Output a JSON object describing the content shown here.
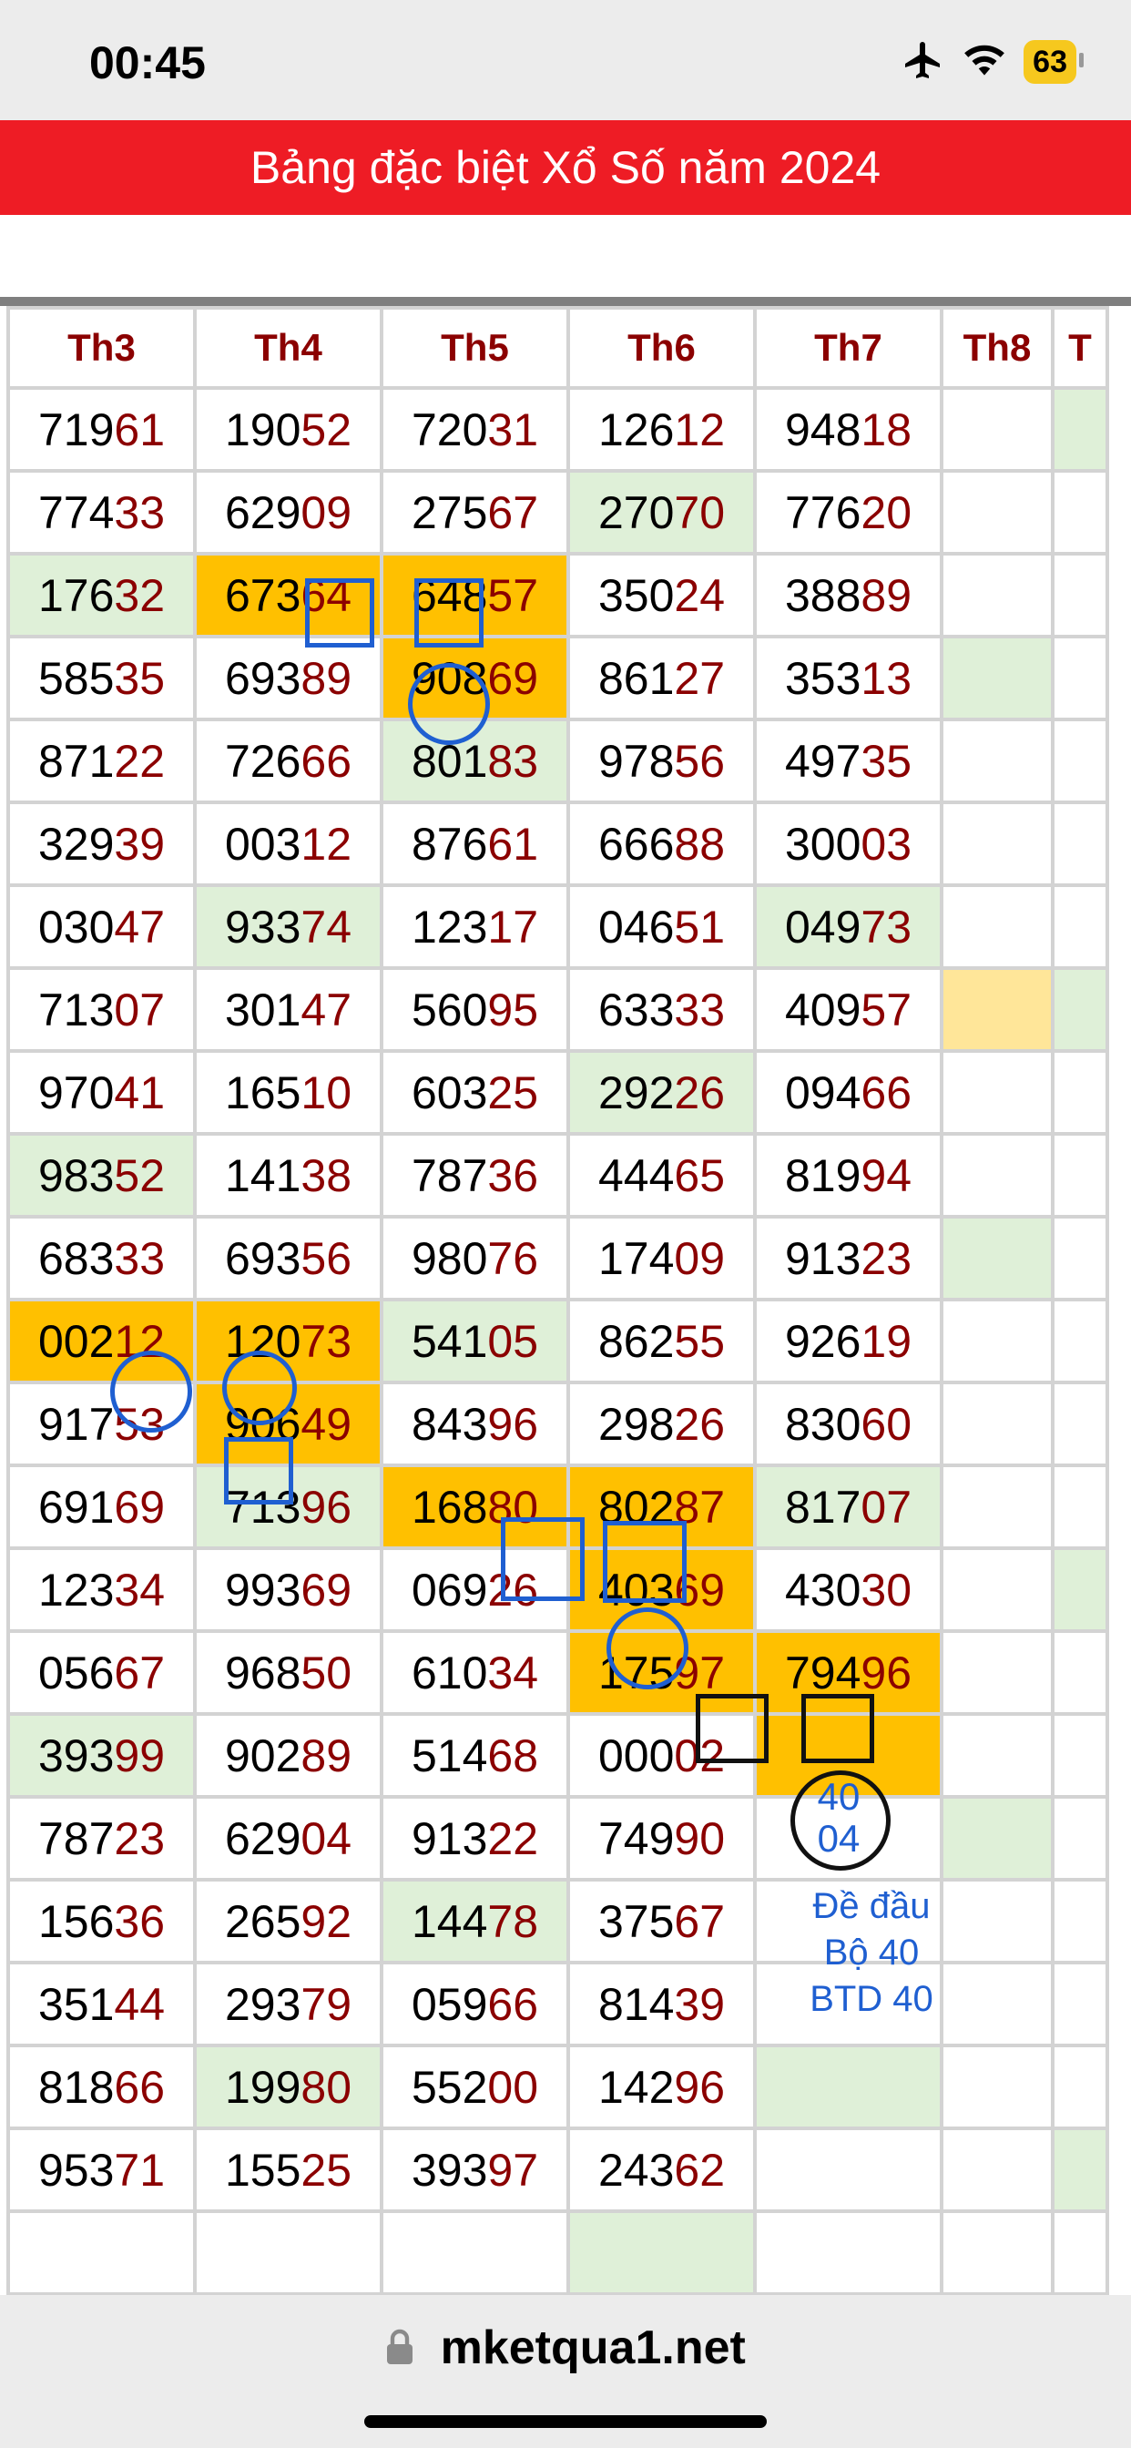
{
  "status": {
    "time": "00:45",
    "battery": "63"
  },
  "header": {
    "title": "Bảng đặc biệt Xổ Số năm 2024"
  },
  "columns": [
    "Th3",
    "Th4",
    "Th5",
    "Th6",
    "Th7",
    "Th8",
    "T"
  ],
  "rows": [
    [
      [
        "719",
        "61",
        ""
      ],
      [
        "190",
        "52",
        ""
      ],
      [
        "720",
        "31",
        ""
      ],
      [
        "126",
        "12",
        ""
      ],
      [
        "948",
        "18",
        ""
      ],
      [
        "",
        "",
        " "
      ],
      [
        "",
        "",
        "g"
      ]
    ],
    [
      [
        "774",
        "33",
        ""
      ],
      [
        "629",
        "09",
        ""
      ],
      [
        "275",
        "67",
        ""
      ],
      [
        "270",
        "70",
        "g"
      ],
      [
        "776",
        "20",
        ""
      ],
      [
        "",
        "",
        ""
      ],
      [
        "",
        "",
        ""
      ]
    ],
    [
      [
        "176",
        "32",
        "g"
      ],
      [
        "673",
        "64",
        "o"
      ],
      [
        "648",
        "57",
        "o"
      ],
      [
        "350",
        "24",
        ""
      ],
      [
        "388",
        "89",
        ""
      ],
      [
        "",
        "",
        ""
      ],
      [
        "",
        "",
        ""
      ]
    ],
    [
      [
        "585",
        "35",
        ""
      ],
      [
        "693",
        "89",
        ""
      ],
      [
        "908",
        "69",
        "o"
      ],
      [
        "861",
        "27",
        ""
      ],
      [
        "353",
        "13",
        ""
      ],
      [
        "",
        "",
        "g"
      ],
      [
        "",
        "",
        ""
      ]
    ],
    [
      [
        "871",
        "22",
        ""
      ],
      [
        "726",
        "66",
        ""
      ],
      [
        "801",
        "83",
        "g"
      ],
      [
        "978",
        "56",
        ""
      ],
      [
        "497",
        "35",
        ""
      ],
      [
        "",
        "",
        ""
      ],
      [
        "",
        "",
        ""
      ]
    ],
    [
      [
        "329",
        "39",
        ""
      ],
      [
        "003",
        "12",
        ""
      ],
      [
        "876",
        "61",
        ""
      ],
      [
        "666",
        "88",
        ""
      ],
      [
        "300",
        "03",
        ""
      ],
      [
        "",
        "",
        ""
      ],
      [
        "",
        "",
        ""
      ]
    ],
    [
      [
        "030",
        "47",
        ""
      ],
      [
        "933",
        "74",
        "g"
      ],
      [
        "123",
        "17",
        ""
      ],
      [
        "046",
        "51",
        ""
      ],
      [
        "049",
        "73",
        "g"
      ],
      [
        "",
        "",
        ""
      ],
      [
        "",
        "",
        ""
      ]
    ],
    [
      [
        "713",
        "07",
        ""
      ],
      [
        "301",
        "47",
        ""
      ],
      [
        "560",
        "95",
        ""
      ],
      [
        "633",
        "33",
        ""
      ],
      [
        "409",
        "57",
        ""
      ],
      [
        "",
        "",
        "y"
      ],
      [
        "",
        "",
        "g"
      ]
    ],
    [
      [
        "970",
        "41",
        ""
      ],
      [
        "165",
        "10",
        ""
      ],
      [
        "603",
        "25",
        ""
      ],
      [
        "292",
        "26",
        "g"
      ],
      [
        "094",
        "66",
        ""
      ],
      [
        "",
        "",
        ""
      ],
      [
        "",
        "",
        ""
      ]
    ],
    [
      [
        "983",
        "52",
        "g"
      ],
      [
        "141",
        "38",
        ""
      ],
      [
        "787",
        "36",
        ""
      ],
      [
        "444",
        "65",
        ""
      ],
      [
        "819",
        "94",
        ""
      ],
      [
        "",
        "",
        ""
      ],
      [
        "",
        "",
        ""
      ]
    ],
    [
      [
        "683",
        "33",
        ""
      ],
      [
        "693",
        "56",
        ""
      ],
      [
        "980",
        "76",
        ""
      ],
      [
        "174",
        "09",
        ""
      ],
      [
        "913",
        "23",
        ""
      ],
      [
        "",
        "",
        "g"
      ],
      [
        "",
        "",
        ""
      ]
    ],
    [
      [
        "002",
        "12",
        "o"
      ],
      [
        "120",
        "73",
        "o"
      ],
      [
        "541",
        "05",
        "g"
      ],
      [
        "862",
        "55",
        ""
      ],
      [
        "926",
        "19",
        ""
      ],
      [
        "",
        "",
        ""
      ],
      [
        "",
        "",
        ""
      ]
    ],
    [
      [
        "917",
        "53",
        ""
      ],
      [
        "906",
        "49",
        "o"
      ],
      [
        "843",
        "96",
        ""
      ],
      [
        "298",
        "26",
        ""
      ],
      [
        "830",
        "60",
        ""
      ],
      [
        "",
        "",
        ""
      ],
      [
        "",
        "",
        ""
      ]
    ],
    [
      [
        "691",
        "69",
        ""
      ],
      [
        "713",
        "96",
        "g"
      ],
      [
        "168",
        "80",
        "o"
      ],
      [
        "802",
        "87",
        "o"
      ],
      [
        "817",
        "07",
        "g"
      ],
      [
        "",
        "",
        ""
      ],
      [
        "",
        "",
        ""
      ]
    ],
    [
      [
        "123",
        "34",
        ""
      ],
      [
        "993",
        "69",
        ""
      ],
      [
        "069",
        "26",
        ""
      ],
      [
        "403",
        "69",
        "o"
      ],
      [
        "430",
        "30",
        ""
      ],
      [
        "",
        "",
        ""
      ],
      [
        "",
        "",
        "g"
      ]
    ],
    [
      [
        "056",
        "67",
        ""
      ],
      [
        "968",
        "50",
        ""
      ],
      [
        "610",
        "34",
        ""
      ],
      [
        "175",
        "97",
        "o"
      ],
      [
        "794",
        "96",
        "o"
      ],
      [
        "",
        "",
        ""
      ],
      [
        "",
        "",
        ""
      ]
    ],
    [
      [
        "393",
        "99",
        "g"
      ],
      [
        "902",
        "89",
        ""
      ],
      [
        "514",
        "68",
        ""
      ],
      [
        "000",
        "02",
        ""
      ],
      [
        "",
        "",
        "o"
      ],
      [
        "",
        "",
        ""
      ],
      [
        "",
        "",
        ""
      ]
    ],
    [
      [
        "787",
        "23",
        ""
      ],
      [
        "629",
        "04",
        ""
      ],
      [
        "913",
        "22",
        ""
      ],
      [
        "749",
        "90",
        ""
      ],
      [
        "",
        "",
        ""
      ],
      [
        "",
        "",
        "g"
      ],
      [
        "",
        "",
        ""
      ]
    ],
    [
      [
        "156",
        "36",
        ""
      ],
      [
        "265",
        "92",
        ""
      ],
      [
        "144",
        "78",
        "g"
      ],
      [
        "375",
        "67",
        ""
      ],
      [
        "",
        "",
        ""
      ],
      [
        "",
        "",
        ""
      ],
      [
        "",
        "",
        ""
      ]
    ],
    [
      [
        "351",
        "44",
        ""
      ],
      [
        "293",
        "79",
        ""
      ],
      [
        "059",
        "66",
        ""
      ],
      [
        "814",
        "39",
        ""
      ],
      [
        "",
        "",
        ""
      ],
      [
        "",
        "",
        ""
      ],
      [
        "",
        "",
        ""
      ]
    ],
    [
      [
        "818",
        "66",
        ""
      ],
      [
        "199",
        "80",
        "g"
      ],
      [
        "552",
        "00",
        ""
      ],
      [
        "142",
        "96",
        ""
      ],
      [
        "",
        "",
        "g"
      ],
      [
        "",
        "",
        ""
      ],
      [
        "",
        "",
        ""
      ]
    ],
    [
      [
        "953",
        "71",
        ""
      ],
      [
        "155",
        "25",
        ""
      ],
      [
        "393",
        "97",
        ""
      ],
      [
        "243",
        "62",
        ""
      ],
      [
        "",
        "",
        ""
      ],
      [
        "",
        "",
        ""
      ],
      [
        "",
        "",
        "g"
      ]
    ],
    [
      [
        "",
        "",
        ""
      ],
      [
        "",
        "",
        ""
      ],
      [
        "",
        "",
        ""
      ],
      [
        "",
        "",
        "g"
      ],
      [
        "",
        "",
        ""
      ],
      [
        "",
        "",
        ""
      ],
      [
        "",
        "",
        ""
      ]
    ]
  ],
  "circled_value": {
    "line1": "40",
    "line2": "04"
  },
  "note": {
    "line1": "Đề đầu",
    "line2": "Bộ 40",
    "line3": "BTD 40"
  },
  "footer": {
    "url": "mketqua1.net"
  },
  "icons": [
    "airplane-icon",
    "wifi-icon",
    "battery-icon",
    "lock-icon"
  ],
  "colors": {
    "banner": "#ee1c25",
    "header_text": "#8b0000",
    "highlight": "#ffc000",
    "light_green": "#dff0d8",
    "light_yellow": "#ffe699",
    "mark_blue": "#1f5fd1"
  }
}
